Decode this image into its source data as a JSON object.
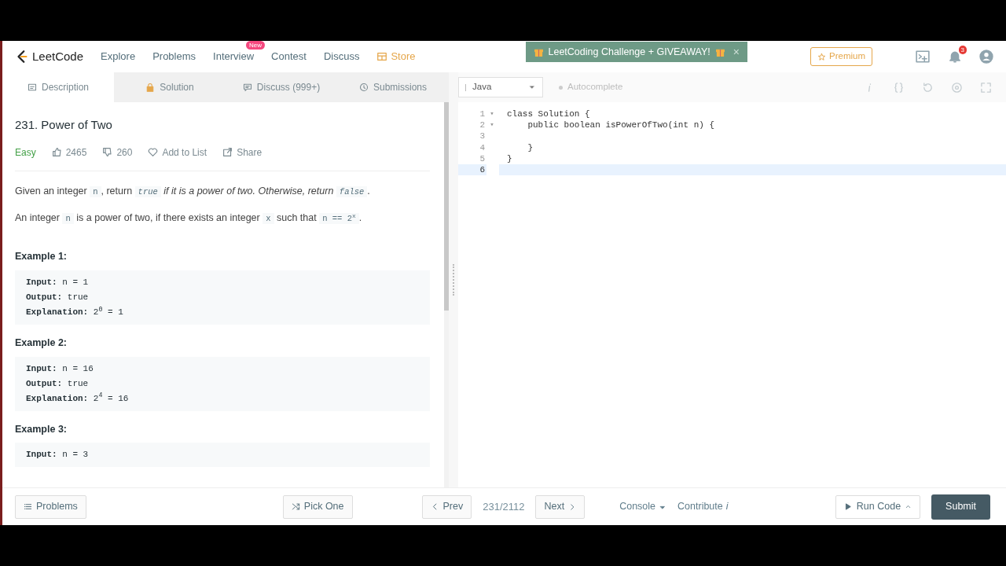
{
  "navbar": {
    "logo": "LeetCode",
    "links": [
      {
        "label": "Explore",
        "kind": "plain"
      },
      {
        "label": "Problems",
        "kind": "plain"
      },
      {
        "label": "Interview",
        "kind": "plain",
        "badge": "New"
      },
      {
        "label": "Contest",
        "kind": "plain"
      },
      {
        "label": "Discuss",
        "kind": "plain"
      },
      {
        "label": "Store",
        "kind": "store"
      }
    ],
    "banner": {
      "text": "LeetCoding Challenge + GIVEAWAY!",
      "close": "×"
    },
    "premium": "Premium",
    "notification_count": "3"
  },
  "tabs": [
    {
      "label": "Description",
      "selected": true
    },
    {
      "label": "Solution",
      "selected": false
    },
    {
      "label": "Discuss (999+)",
      "selected": false
    },
    {
      "label": "Submissions",
      "selected": false
    }
  ],
  "editor_toolbar": {
    "language": "Java",
    "autocomplete": {
      "label": "Autocomplete",
      "on": false
    }
  },
  "problem": {
    "title": "231. Power of Two",
    "difficulty": "Easy",
    "likes": "2465",
    "dislikes": "260",
    "add_to_list": "Add to List",
    "share": "Share",
    "paragraphs": [
      [
        {
          "kind": "text",
          "text": "Given an integer "
        },
        {
          "kind": "code",
          "text": "n"
        },
        {
          "kind": "text",
          "text": ", return "
        },
        {
          "kind": "code",
          "text": "*true*"
        },
        {
          "kind": "text",
          "text": " *if it is a power of two. Otherwise, return* "
        },
        {
          "kind": "code",
          "text": "*false*"
        },
        {
          "kind": "text",
          "text": "."
        }
      ],
      [
        {
          "kind": "text",
          "text": "An integer "
        },
        {
          "kind": "code",
          "text": "n"
        },
        {
          "kind": "text",
          "text": " is a power of two, if there exists an integer "
        },
        {
          "kind": "code",
          "text": "x"
        },
        {
          "kind": "text",
          "text": " such that "
        },
        {
          "kind": "code",
          "text": "n == 2$^{x}$"
        },
        {
          "kind": "text",
          "text": "."
        }
      ]
    ],
    "examples": [
      {
        "title": "Example 1:",
        "lines": [
          {
            "label": "Input:",
            "value": "n = 1"
          },
          {
            "label": "Output:",
            "value": "true"
          },
          {
            "label": "Explanation:",
            "value": "2$^{0}$ = 1"
          }
        ]
      },
      {
        "title": "Example 2:",
        "lines": [
          {
            "label": "Input:",
            "value": "n = 16"
          },
          {
            "label": "Output:",
            "value": "true"
          },
          {
            "label": "Explanation:",
            "value": "2$^{4}$ = 16"
          }
        ]
      },
      {
        "title": "Example 3:",
        "lines": [
          {
            "label": "Input:",
            "value": "n = 3"
          }
        ]
      }
    ]
  },
  "code_lines": [
    {
      "number": "1",
      "text": "class Solution {",
      "fold_marker": "▾",
      "active": false
    },
    {
      "number": "2",
      "text": "    public boolean isPowerOfTwo(int n) {",
      "fold_marker": "▾",
      "active": false
    },
    {
      "number": "3",
      "active": false
    },
    {
      "number": "4",
      "text": "    }",
      "active": false
    },
    {
      "number": "5",
      "text": "}",
      "active": false
    },
    {
      "number": "6",
      "active": true
    }
  ],
  "footer": {
    "problems": "Problems",
    "pick_one": "Pick One",
    "prev": "Prev",
    "position": "231/2112",
    "next": "Next",
    "console": "Console",
    "contribute": "Contribute",
    "contribute_mark": "i",
    "run_code": "Run Code",
    "submit": "Submit"
  }
}
